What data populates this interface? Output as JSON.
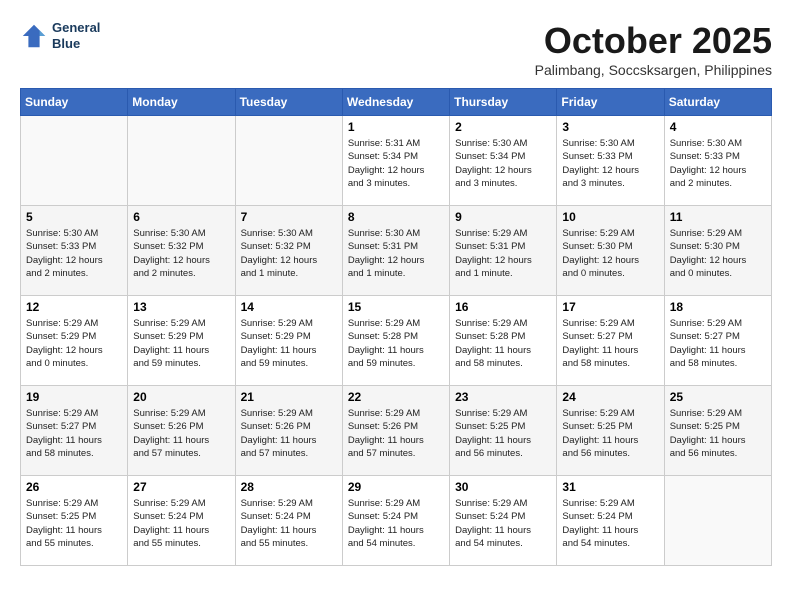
{
  "header": {
    "logo_line1": "General",
    "logo_line2": "Blue",
    "month_year": "October 2025",
    "location": "Palimbang, Soccsksargen, Philippines"
  },
  "weekdays": [
    "Sunday",
    "Monday",
    "Tuesday",
    "Wednesday",
    "Thursday",
    "Friday",
    "Saturday"
  ],
  "weeks": [
    [
      {
        "day": "",
        "info": ""
      },
      {
        "day": "",
        "info": ""
      },
      {
        "day": "",
        "info": ""
      },
      {
        "day": "1",
        "info": "Sunrise: 5:31 AM\nSunset: 5:34 PM\nDaylight: 12 hours\nand 3 minutes."
      },
      {
        "day": "2",
        "info": "Sunrise: 5:30 AM\nSunset: 5:34 PM\nDaylight: 12 hours\nand 3 minutes."
      },
      {
        "day": "3",
        "info": "Sunrise: 5:30 AM\nSunset: 5:33 PM\nDaylight: 12 hours\nand 3 minutes."
      },
      {
        "day": "4",
        "info": "Sunrise: 5:30 AM\nSunset: 5:33 PM\nDaylight: 12 hours\nand 2 minutes."
      }
    ],
    [
      {
        "day": "5",
        "info": "Sunrise: 5:30 AM\nSunset: 5:33 PM\nDaylight: 12 hours\nand 2 minutes."
      },
      {
        "day": "6",
        "info": "Sunrise: 5:30 AM\nSunset: 5:32 PM\nDaylight: 12 hours\nand 2 minutes."
      },
      {
        "day": "7",
        "info": "Sunrise: 5:30 AM\nSunset: 5:32 PM\nDaylight: 12 hours\nand 1 minute."
      },
      {
        "day": "8",
        "info": "Sunrise: 5:30 AM\nSunset: 5:31 PM\nDaylight: 12 hours\nand 1 minute."
      },
      {
        "day": "9",
        "info": "Sunrise: 5:29 AM\nSunset: 5:31 PM\nDaylight: 12 hours\nand 1 minute."
      },
      {
        "day": "10",
        "info": "Sunrise: 5:29 AM\nSunset: 5:30 PM\nDaylight: 12 hours\nand 0 minutes."
      },
      {
        "day": "11",
        "info": "Sunrise: 5:29 AM\nSunset: 5:30 PM\nDaylight: 12 hours\nand 0 minutes."
      }
    ],
    [
      {
        "day": "12",
        "info": "Sunrise: 5:29 AM\nSunset: 5:29 PM\nDaylight: 12 hours\nand 0 minutes."
      },
      {
        "day": "13",
        "info": "Sunrise: 5:29 AM\nSunset: 5:29 PM\nDaylight: 11 hours\nand 59 minutes."
      },
      {
        "day": "14",
        "info": "Sunrise: 5:29 AM\nSunset: 5:29 PM\nDaylight: 11 hours\nand 59 minutes."
      },
      {
        "day": "15",
        "info": "Sunrise: 5:29 AM\nSunset: 5:28 PM\nDaylight: 11 hours\nand 59 minutes."
      },
      {
        "day": "16",
        "info": "Sunrise: 5:29 AM\nSunset: 5:28 PM\nDaylight: 11 hours\nand 58 minutes."
      },
      {
        "day": "17",
        "info": "Sunrise: 5:29 AM\nSunset: 5:27 PM\nDaylight: 11 hours\nand 58 minutes."
      },
      {
        "day": "18",
        "info": "Sunrise: 5:29 AM\nSunset: 5:27 PM\nDaylight: 11 hours\nand 58 minutes."
      }
    ],
    [
      {
        "day": "19",
        "info": "Sunrise: 5:29 AM\nSunset: 5:27 PM\nDaylight: 11 hours\nand 58 minutes."
      },
      {
        "day": "20",
        "info": "Sunrise: 5:29 AM\nSunset: 5:26 PM\nDaylight: 11 hours\nand 57 minutes."
      },
      {
        "day": "21",
        "info": "Sunrise: 5:29 AM\nSunset: 5:26 PM\nDaylight: 11 hours\nand 57 minutes."
      },
      {
        "day": "22",
        "info": "Sunrise: 5:29 AM\nSunset: 5:26 PM\nDaylight: 11 hours\nand 57 minutes."
      },
      {
        "day": "23",
        "info": "Sunrise: 5:29 AM\nSunset: 5:25 PM\nDaylight: 11 hours\nand 56 minutes."
      },
      {
        "day": "24",
        "info": "Sunrise: 5:29 AM\nSunset: 5:25 PM\nDaylight: 11 hours\nand 56 minutes."
      },
      {
        "day": "25",
        "info": "Sunrise: 5:29 AM\nSunset: 5:25 PM\nDaylight: 11 hours\nand 56 minutes."
      }
    ],
    [
      {
        "day": "26",
        "info": "Sunrise: 5:29 AM\nSunset: 5:25 PM\nDaylight: 11 hours\nand 55 minutes."
      },
      {
        "day": "27",
        "info": "Sunrise: 5:29 AM\nSunset: 5:24 PM\nDaylight: 11 hours\nand 55 minutes."
      },
      {
        "day": "28",
        "info": "Sunrise: 5:29 AM\nSunset: 5:24 PM\nDaylight: 11 hours\nand 55 minutes."
      },
      {
        "day": "29",
        "info": "Sunrise: 5:29 AM\nSunset: 5:24 PM\nDaylight: 11 hours\nand 54 minutes."
      },
      {
        "day": "30",
        "info": "Sunrise: 5:29 AM\nSunset: 5:24 PM\nDaylight: 11 hours\nand 54 minutes."
      },
      {
        "day": "31",
        "info": "Sunrise: 5:29 AM\nSunset: 5:24 PM\nDaylight: 11 hours\nand 54 minutes."
      },
      {
        "day": "",
        "info": ""
      }
    ]
  ]
}
